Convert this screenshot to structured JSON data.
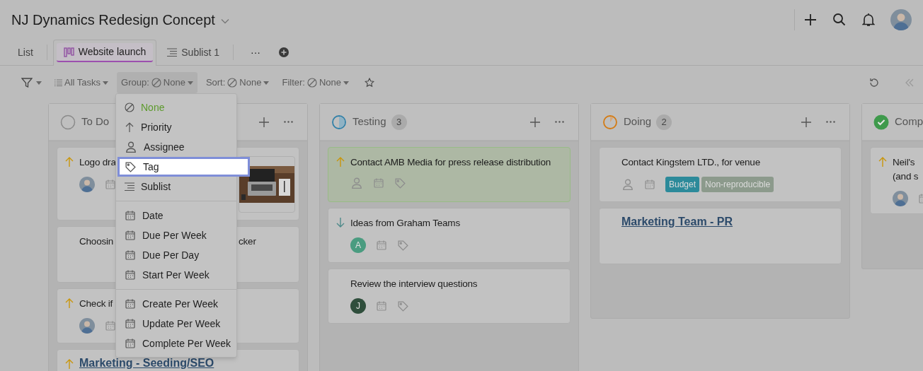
{
  "header": {
    "title": "NJ Dynamics Redesign Concept"
  },
  "tabs": [
    {
      "label": "List",
      "kind": "plain",
      "selected": false
    },
    {
      "label": "Website launch",
      "kind": "board",
      "selected": true
    },
    {
      "label": "Sublist 1",
      "kind": "sublist",
      "selected": false
    }
  ],
  "tabs_more": "···",
  "toolbar": {
    "view": "All Tasks",
    "controls": [
      {
        "prefix": "Group:",
        "value": "None",
        "open": true
      },
      {
        "prefix": "Sort:",
        "value": "None",
        "open": false
      },
      {
        "prefix": "Filter:",
        "value": "None",
        "open": false
      }
    ]
  },
  "group_menu": {
    "sections": [
      [
        {
          "label": "None",
          "kind": "none",
          "selected": true,
          "highlighted": false
        },
        {
          "label": "Priority",
          "kind": "arrow",
          "selected": false,
          "highlighted": false
        },
        {
          "label": "Assignee",
          "kind": "person",
          "selected": false,
          "highlighted": false
        },
        {
          "label": "Tag",
          "kind": "tag",
          "selected": false,
          "highlighted": true
        },
        {
          "label": "Sublist",
          "kind": "sublist",
          "selected": false,
          "highlighted": false
        }
      ],
      [
        {
          "label": "Date",
          "kind": "calendar",
          "selected": false,
          "highlighted": false
        },
        {
          "label": "Due Per Week",
          "kind": "calendar",
          "selected": false,
          "highlighted": false
        },
        {
          "label": "Due Per Day",
          "kind": "calendar",
          "selected": false,
          "highlighted": false
        },
        {
          "label": "Start Per Week",
          "kind": "calendar",
          "selected": false,
          "highlighted": false
        }
      ],
      [
        {
          "label": "Create Per Week",
          "kind": "calendar",
          "selected": false,
          "highlighted": false
        },
        {
          "label": "Update Per Week",
          "kind": "calendar",
          "selected": false,
          "highlighted": false
        },
        {
          "label": "Complete Per Week",
          "kind": "calendar",
          "selected": false,
          "highlighted": false
        }
      ]
    ]
  },
  "columns": [
    {
      "name": "To Do",
      "kind": "todo",
      "actions": true,
      "cards": [
        {
          "priority": {
            "kind": "up"
          },
          "title": "Logo dra",
          "highlighted": false,
          "date_icon": true,
          "picture": true
        },
        {
          "title": "Choosin",
          "title_tail": "cker",
          "highlighted": false
        },
        {
          "priority": {
            "kind": "up"
          },
          "title": "Check if",
          "highlighted": false,
          "date_icon": true
        },
        {
          "priority": {
            "kind": "up"
          },
          "title": "Marketing - Seeding/SEO",
          "link": true,
          "highlighted": false
        }
      ]
    },
    {
      "name": "Testing",
      "kind": "testing",
      "count": "3",
      "actions": true,
      "cards": [
        {
          "priority": {
            "kind": "up"
          },
          "title": "Contact AMB Media for press release distribution",
          "highlighted": true,
          "assignee": {
            "kind": "empty"
          },
          "date_icon": true,
          "tag_icon": true
        },
        {
          "priority": {
            "kind": "down"
          },
          "title": "Ideas from Graham Teams",
          "highlighted": false,
          "assignee": {
            "kind": "initial",
            "initial": "A",
            "color": "#4a9c80"
          },
          "date_icon": true,
          "tag_icon": true
        },
        {
          "title": "Review the interview questions",
          "highlighted": false,
          "assignee": {
            "kind": "initial",
            "initial": "J",
            "color": "#2f4e3c"
          },
          "date_icon": true,
          "tag_icon": true
        }
      ]
    },
    {
      "name": "Doing",
      "kind": "doing",
      "count": "2",
      "actions": true,
      "cards": [
        {
          "title": "Contact Kingstem LTD., for venue",
          "highlighted": false,
          "assignee": {
            "kind": "empty"
          },
          "date_icon": true,
          "tags": [
            {
              "label": "Budget",
              "color": "#2c8a9a"
            },
            {
              "label": "Non-reproducible",
              "color": "#8c9a8c"
            }
          ]
        },
        {
          "title": "Marketing Team - PR",
          "link": true,
          "highlighted": false
        }
      ]
    },
    {
      "name": "Comp",
      "kind": "complete",
      "actions": false,
      "cards": [
        {
          "priority": {
            "kind": "up"
          },
          "title": "Neil's\n(and s",
          "highlighted": false,
          "date_icon": true
        }
      ]
    }
  ]
}
